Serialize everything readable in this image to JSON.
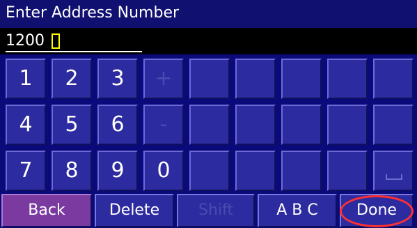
{
  "title": "Enter Address Number",
  "input": {
    "value": "1200"
  },
  "keys": {
    "k1": "1",
    "k2": "2",
    "k3": "3",
    "plus": "+",
    "k4": "4",
    "k5": "5",
    "k6": "6",
    "minus": "-",
    "k7": "7",
    "k8": "8",
    "k9": "9",
    "k0": "0"
  },
  "buttons": {
    "back": "Back",
    "delete": "Delete",
    "shift": "Shift",
    "abc": "A B C",
    "done": "Done"
  }
}
